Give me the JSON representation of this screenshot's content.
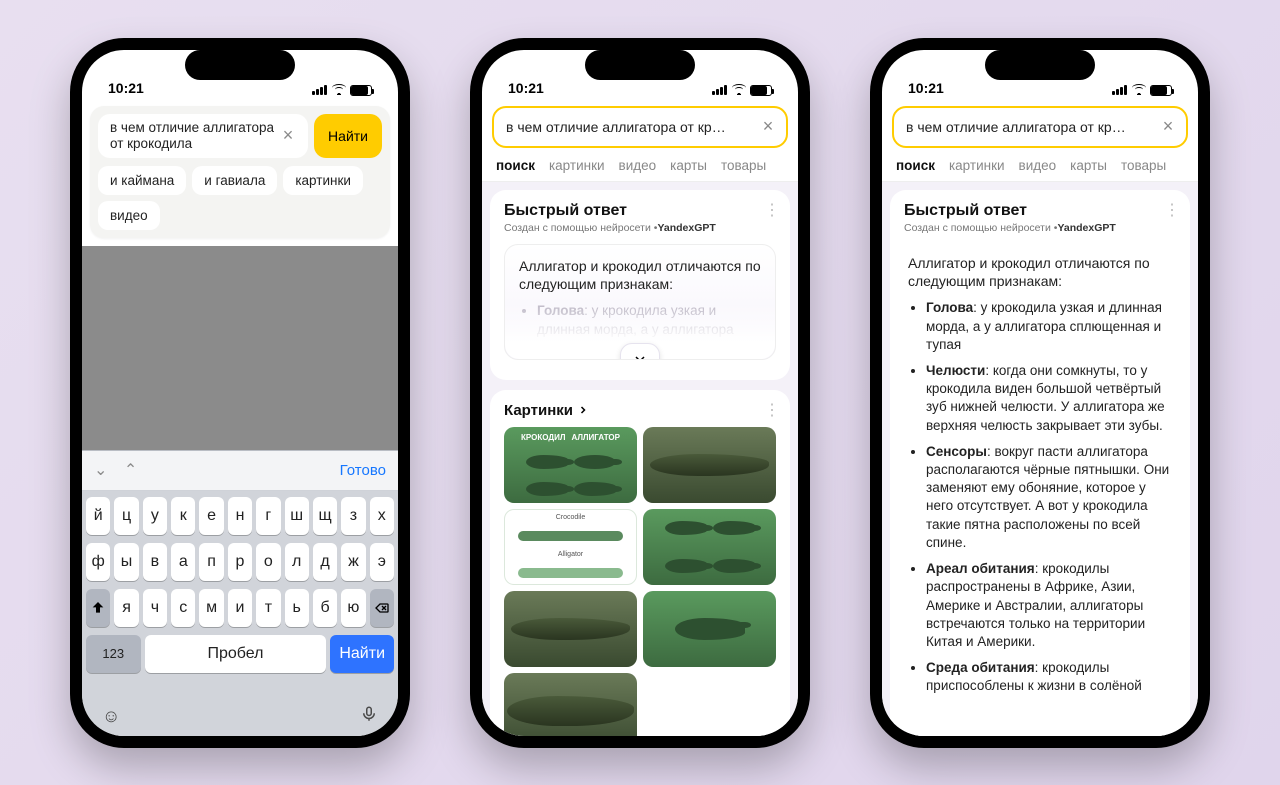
{
  "status": {
    "time": "10:21"
  },
  "phone1": {
    "query": "в чем отличие аллигатора от крокодила",
    "find": "Найти",
    "suggestions": [
      "и каймана",
      "и гавиала",
      "картинки",
      "видео"
    ],
    "keyboard": {
      "done": "Готово",
      "rows": [
        [
          "й",
          "ц",
          "у",
          "к",
          "е",
          "н",
          "г",
          "ш",
          "щ",
          "з",
          "х"
        ],
        [
          "ф",
          "ы",
          "в",
          "а",
          "п",
          "р",
          "о",
          "л",
          "д",
          "ж",
          "э"
        ],
        [
          "я",
          "ч",
          "с",
          "м",
          "и",
          "т",
          "ь",
          "б",
          "ю"
        ]
      ],
      "numkey": "123",
      "space": "Пробел",
      "search": "Найти"
    }
  },
  "phone2": {
    "query_trunc": "в чем отличие аллигатора от кр…",
    "tabs": [
      "поиск",
      "картинки",
      "видео",
      "карты",
      "товары"
    ],
    "qa_title": "Быстрый ответ",
    "qa_sub_pre": "Создан с помощью нейросети ",
    "qa_sub_brand": "YandexGPT",
    "intro": "Аллигатор и крокодил отличаются по следующим признакам:",
    "bullets": [
      {
        "term": "Голова",
        "text": ": у крокодила узкая и длинная морда, а у аллигатора"
      }
    ],
    "images_title": "Картинки",
    "tile_labels": {
      "croc": "КРОКОДИЛ",
      "alli": "АЛЛИГАТОР",
      "croc_en": "Crocodile",
      "alli_en": "Alligator"
    }
  },
  "phone3": {
    "query_trunc": "в чем отличие аллигатора от кр…",
    "tabs": [
      "поиск",
      "картинки",
      "видео",
      "карты",
      "товары"
    ],
    "qa_title": "Быстрый ответ",
    "qa_sub_pre": "Создан с помощью нейросети ",
    "qa_sub_brand": "YandexGPT",
    "intro": "Аллигатор и крокодил отличаются по следующим признакам:",
    "bullets": [
      {
        "term": "Голова",
        "text": ": у крокодила узкая и длинная морда, а у аллигатора сплющенная и тупая"
      },
      {
        "term": "Челюсти",
        "text": ": когда они сомкнуты, то у крокодила виден большой четвёртый зуб нижней челюсти. У аллигатора же верхняя челюсть закрывает эти зубы."
      },
      {
        "term": "Сенсоры",
        "text": ": вокруг пасти аллигатора располагаются чёрные пятнышки. Они заменяют ему обоняние, которое у него отсутствует. А вот у крокодила такие пятна расположены по всей спине."
      },
      {
        "term": "Ареал обитания",
        "text": ": крокодилы распространены в Африке, Азии, Америке и Австралии, аллигаторы встречаются только на территории Китая и Америки."
      },
      {
        "term": "Среда обитания",
        "text": ": крокодилы приспособлены к жизни в солёной"
      }
    ]
  }
}
